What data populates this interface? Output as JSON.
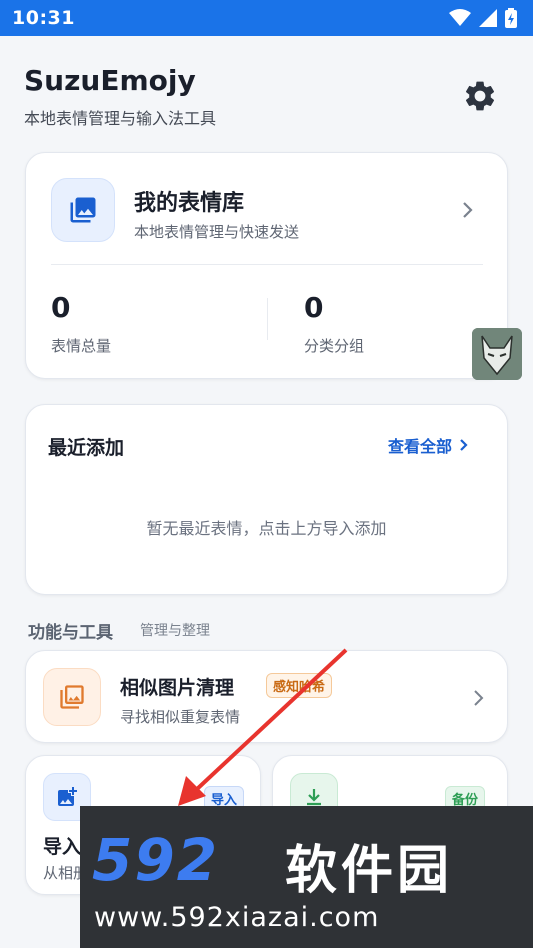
{
  "status_bar": {
    "time": "10:31"
  },
  "header": {
    "title": "SuzuEmojy",
    "subtitle": "本地表情管理与输入法工具"
  },
  "library_card": {
    "title": "我的表情库",
    "subtitle": "本地表情管理与快速发送",
    "stats": [
      {
        "value": "0",
        "label": "表情总量"
      },
      {
        "value": "0",
        "label": "分类分组"
      }
    ]
  },
  "recent": {
    "title": "最近添加",
    "view_all": "查看全部",
    "empty": "暂无最近表情，点击上方导入添加"
  },
  "tools": {
    "title": "功能与工具",
    "subtitle": "管理与整理",
    "similar": {
      "title": "相似图片清理",
      "badge": "感知哈希",
      "subtitle": "寻找相似重复表情"
    },
    "import": {
      "title": "导入",
      "badge": "导入",
      "subtitle": "从相册"
    },
    "backup": {
      "badge": "备份"
    }
  },
  "watermark": {
    "logo": "592",
    "name": "软件园",
    "url": "www.592xiazai.com"
  },
  "colors": {
    "accent": "#1a73e8",
    "link": "#1a5fd0",
    "orange": "#e07a2e",
    "green": "#2e9e55"
  }
}
